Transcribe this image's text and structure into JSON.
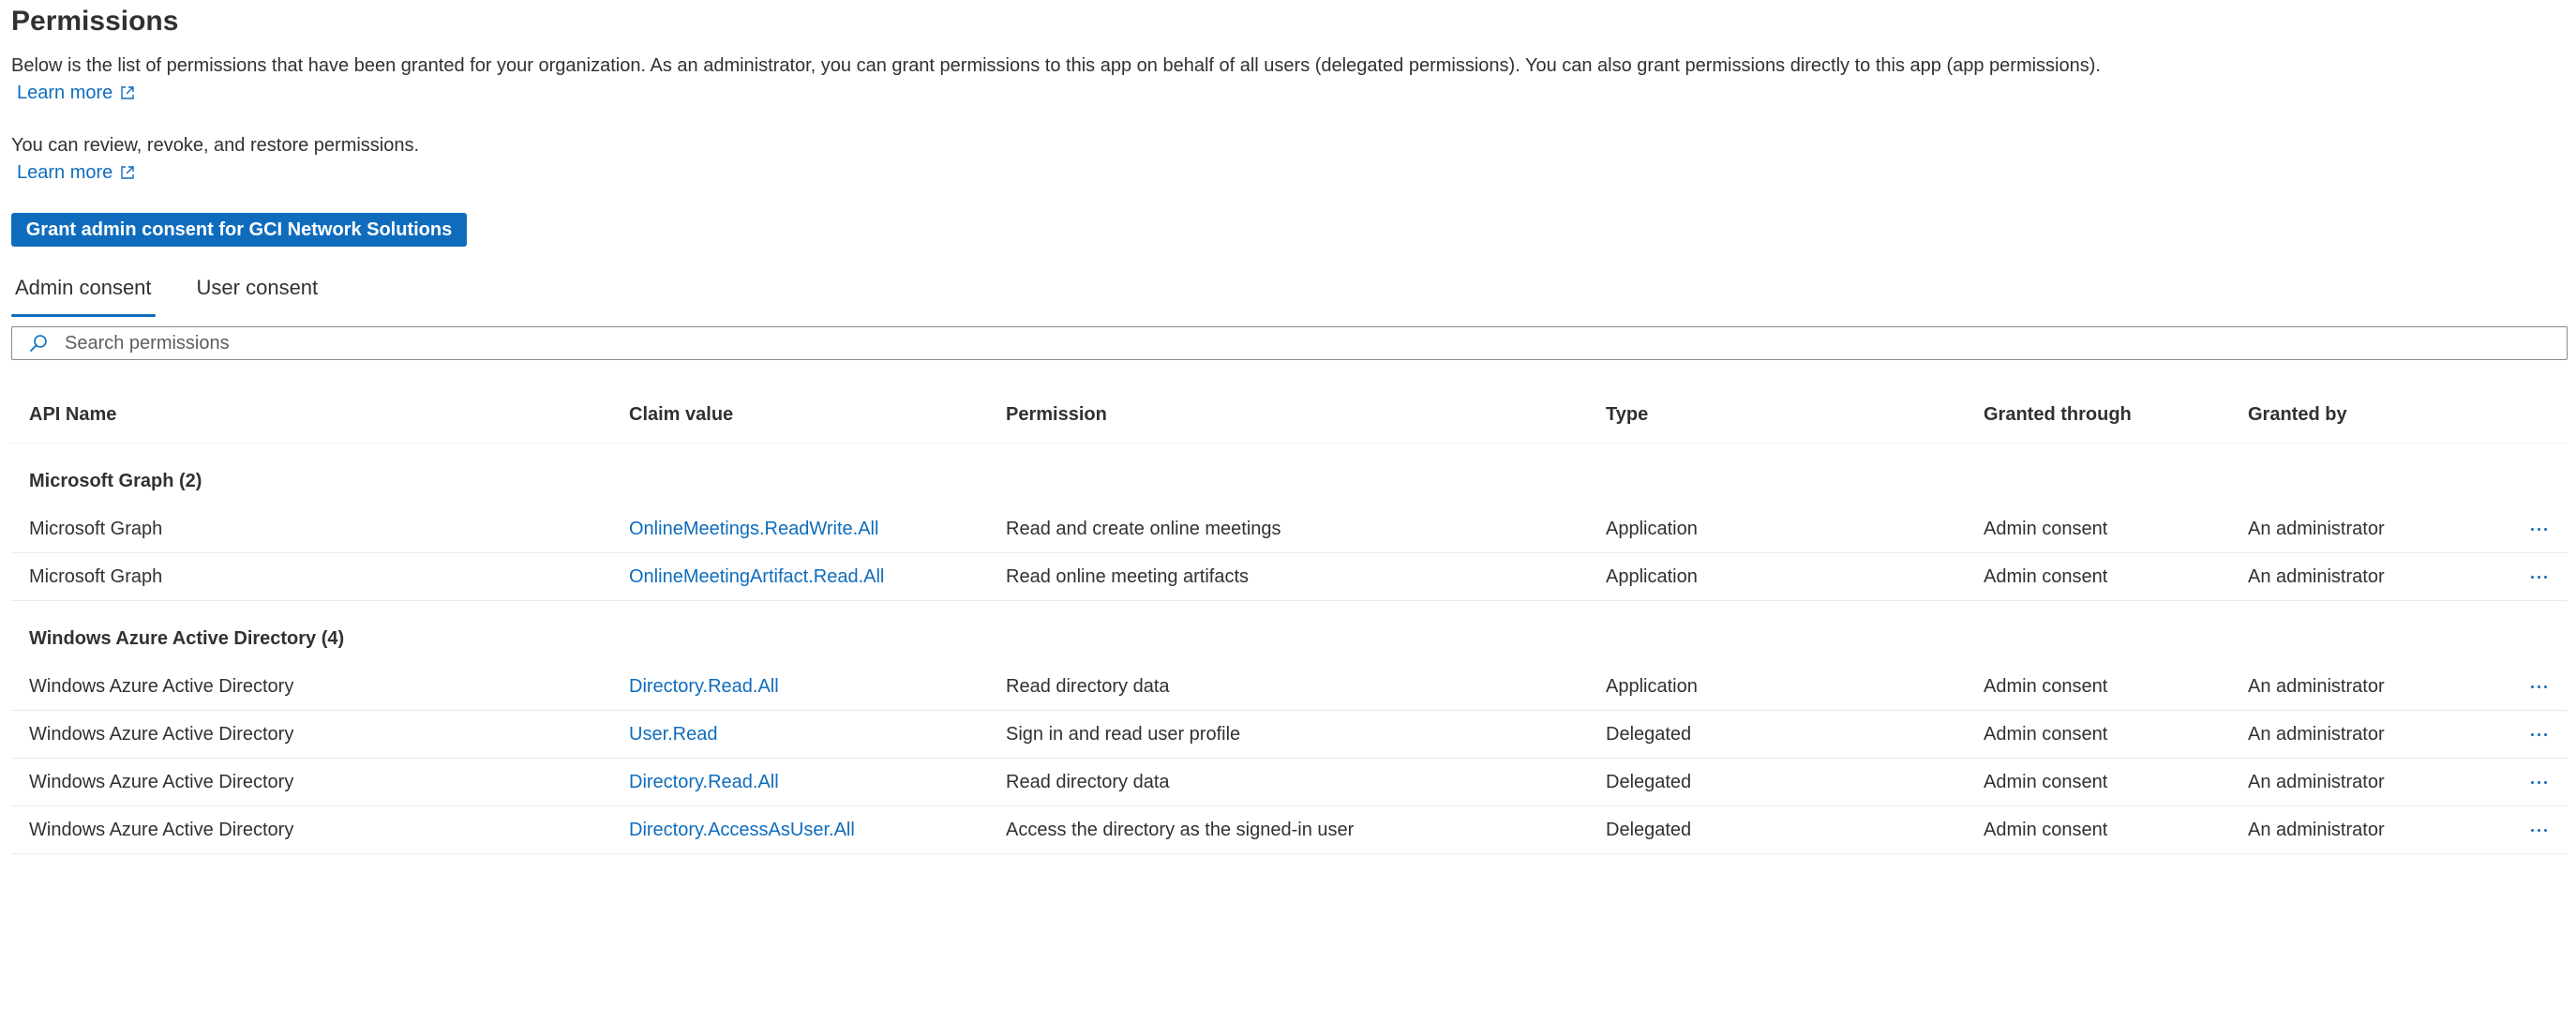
{
  "page": {
    "title": "Permissions",
    "description": "Below is the list of permissions that have been granted for your organization. As an administrator, you can grant permissions to this app on behalf of all users (delegated permissions). You can also grant permissions directly to this app (app permissions).",
    "learn_more_1": "Learn more",
    "review_text": "You can review, revoke, and restore permissions.",
    "learn_more_2": "Learn more",
    "grant_button": "Grant admin consent for GCI Network Solutions"
  },
  "tabs": [
    {
      "label": "Admin consent",
      "active": true
    },
    {
      "label": "User consent",
      "active": false
    }
  ],
  "search": {
    "placeholder": "Search permissions",
    "value": ""
  },
  "table": {
    "columns": [
      "API Name",
      "Claim value",
      "Permission",
      "Type",
      "Granted through",
      "Granted by"
    ],
    "groups": [
      {
        "label": "Microsoft Graph (2)",
        "rows": [
          {
            "api": "Microsoft Graph",
            "claim": "OnlineMeetings.ReadWrite.All",
            "permission": "Read and create online meetings",
            "type": "Application",
            "through": "Admin consent",
            "by": "An administrator"
          },
          {
            "api": "Microsoft Graph",
            "claim": "OnlineMeetingArtifact.Read.All",
            "permission": "Read online meeting artifacts",
            "type": "Application",
            "through": "Admin consent",
            "by": "An administrator"
          }
        ]
      },
      {
        "label": "Windows Azure Active Directory (4)",
        "rows": [
          {
            "api": "Windows Azure Active Directory",
            "claim": "Directory.Read.All",
            "permission": "Read directory data",
            "type": "Application",
            "through": "Admin consent",
            "by": "An administrator"
          },
          {
            "api": "Windows Azure Active Directory",
            "claim": "User.Read",
            "permission": "Sign in and read user profile",
            "type": "Delegated",
            "through": "Admin consent",
            "by": "An administrator"
          },
          {
            "api": "Windows Azure Active Directory",
            "claim": "Directory.Read.All",
            "permission": "Read directory data",
            "type": "Delegated",
            "through": "Admin consent",
            "by": "An administrator"
          },
          {
            "api": "Windows Azure Active Directory",
            "claim": "Directory.AccessAsUser.All",
            "permission": "Access the directory as the signed-in user",
            "type": "Delegated",
            "through": "Admin consent",
            "by": "An administrator"
          }
        ]
      }
    ]
  },
  "icons": {
    "external_link": "external-link-icon",
    "search": "search-icon",
    "more": "more-icon"
  },
  "colors": {
    "accent": "#0f6cbd",
    "text": "#323130",
    "divider": "#edebe9"
  }
}
